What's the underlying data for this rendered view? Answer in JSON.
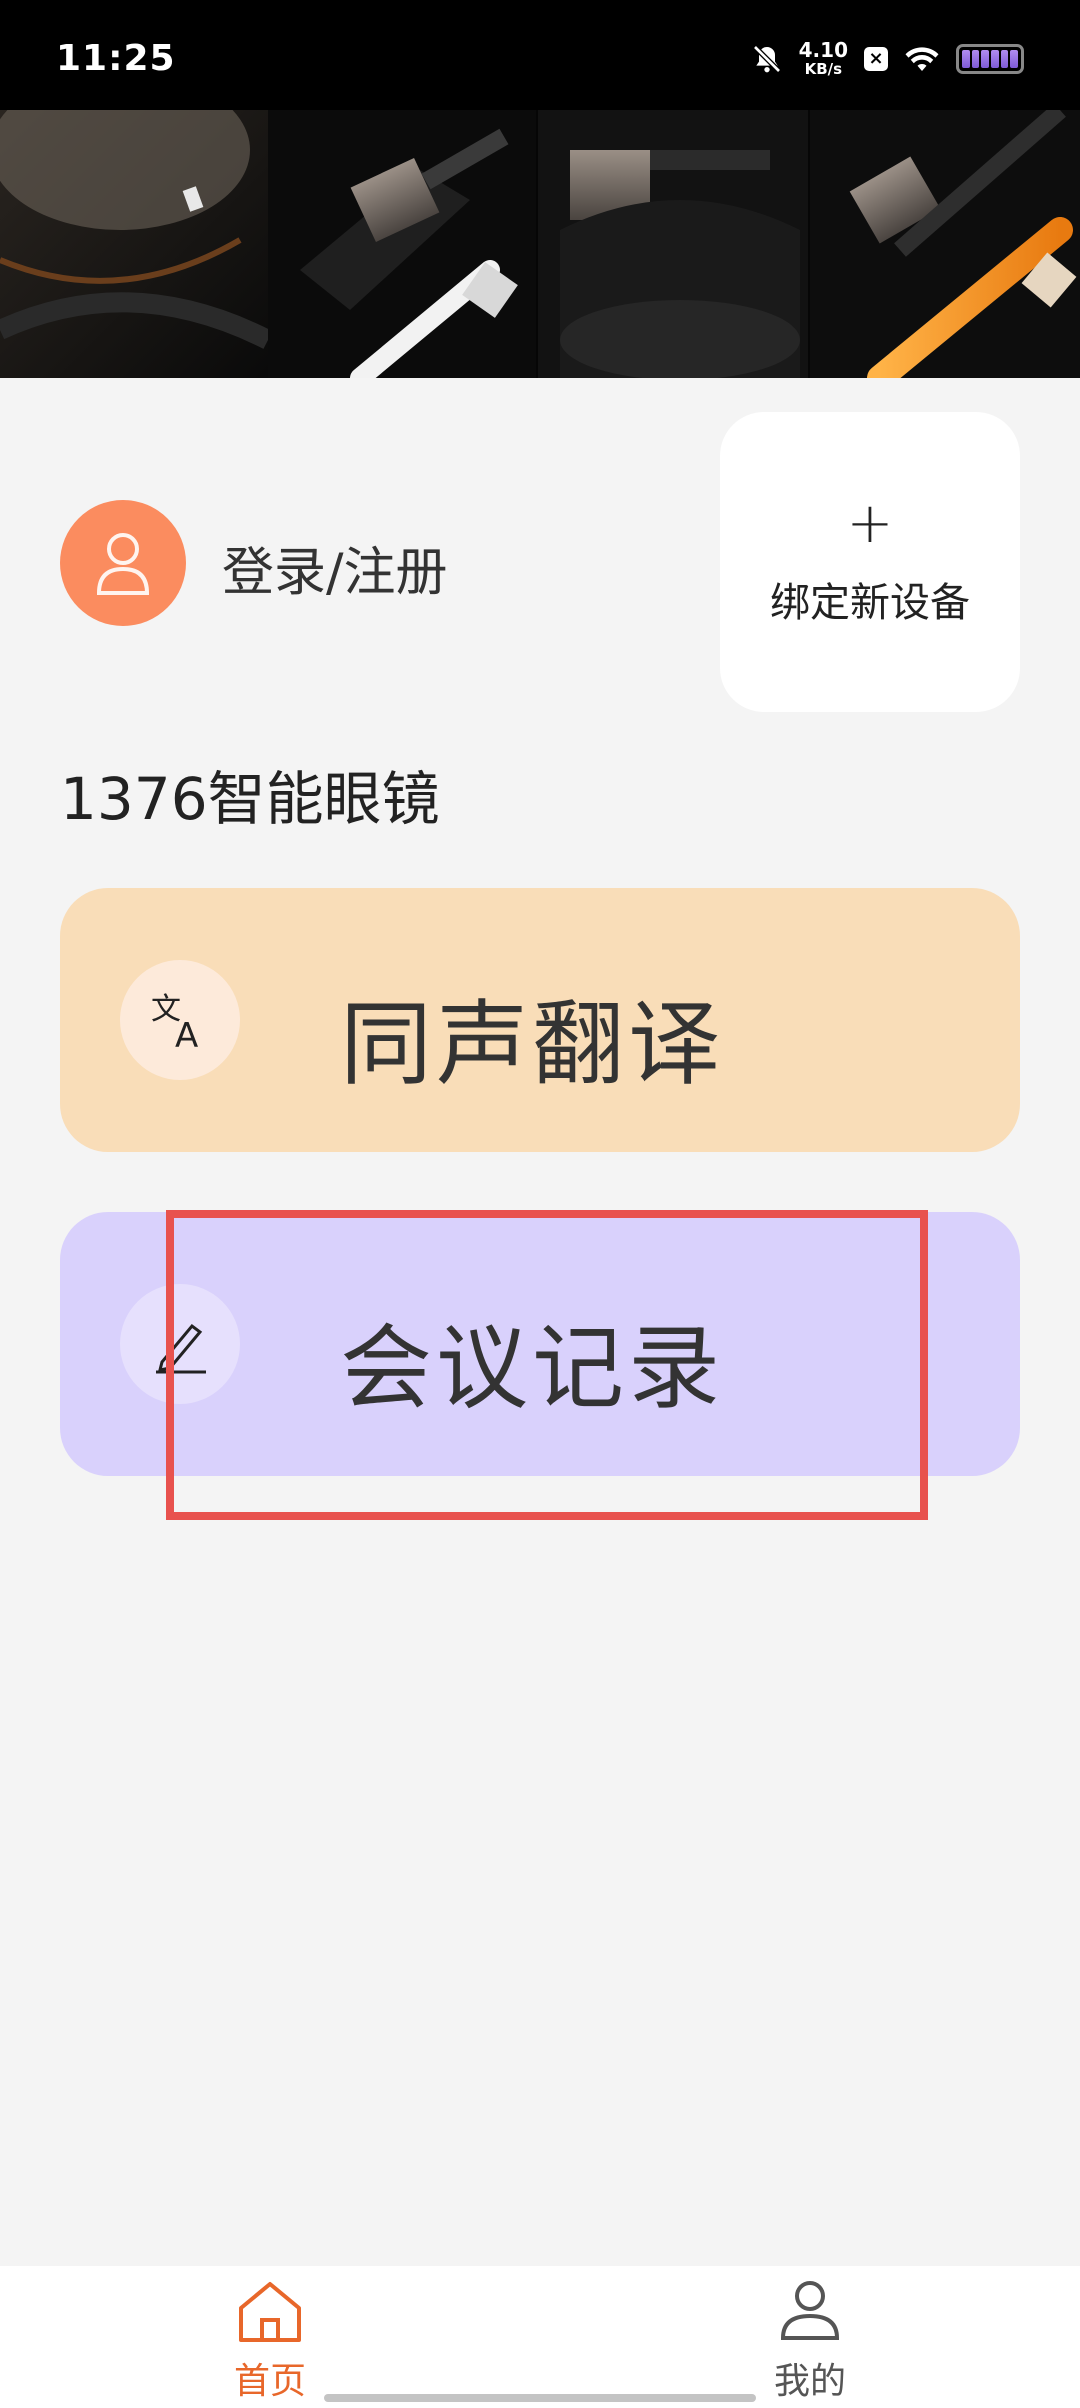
{
  "status_bar": {
    "time": "11:25",
    "net_speed_value": "4.10",
    "net_speed_unit": "KB/s",
    "icons": [
      "bell-off-icon",
      "x-notification-icon",
      "wifi-icon",
      "battery-icon"
    ]
  },
  "hero": {
    "image": "smart-glasses-closeup-banner"
  },
  "profile": {
    "avatar_icon": "user-icon",
    "login_label": "登录/注册"
  },
  "bind_device": {
    "plus": "+",
    "label": "绑定新设备"
  },
  "device_title": "1376智能眼镜",
  "features": [
    {
      "label": "同声翻译",
      "icon": "translate-icon",
      "color": "#f9ddb8"
    },
    {
      "label": "会议记录",
      "icon": "pencil-icon",
      "color": "#d9d1fc"
    }
  ],
  "bottom_nav": {
    "home": {
      "label": "首页",
      "icon": "home-icon",
      "active": true,
      "color": "#e8672a"
    },
    "mine": {
      "label": "我的",
      "icon": "person-icon",
      "active": false
    }
  },
  "colors": {
    "accent": "#e8672a",
    "avatar": "#fb8c5f",
    "highlight": "#e8524e"
  }
}
